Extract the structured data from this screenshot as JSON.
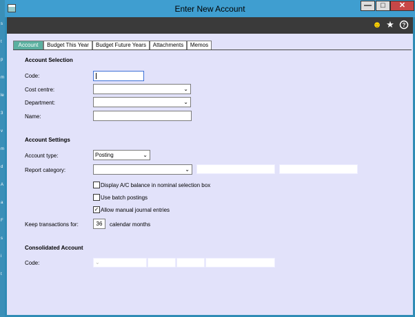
{
  "window": {
    "title": "Enter New Account",
    "controls": {
      "minimize": "—",
      "maximize": "□",
      "close": "✕"
    }
  },
  "edge_glyphs": [
    "s",
    "t",
    "p",
    "m",
    "le",
    "3",
    "v",
    "m",
    "d",
    "A",
    "a",
    "F",
    "s",
    "i",
    "t"
  ],
  "header_icons": {
    "smile": "☻",
    "star": "★",
    "help": "?"
  },
  "tabs": [
    {
      "label": "Account",
      "active": true
    },
    {
      "label": "Budget This Year",
      "active": false
    },
    {
      "label": "Budget Future Years",
      "active": false
    },
    {
      "label": "Attachments",
      "active": false
    },
    {
      "label": "Memos",
      "active": false
    }
  ],
  "account_selection": {
    "heading": "Account Selection",
    "code_label": "Code:",
    "code_value": "",
    "cost_centre_label": "Cost centre:",
    "cost_centre_value": "",
    "department_label": "Department:",
    "department_value": "",
    "name_label": "Name:",
    "name_value": ""
  },
  "account_settings": {
    "heading": "Account Settings",
    "account_type_label": "Account type:",
    "account_type_value": "Posting",
    "report_category_label": "Report category:",
    "report_category_value": "",
    "display_balance_label": "Display A/C balance in nominal selection box",
    "display_balance_checked": false,
    "batch_postings_label": "Use batch postings",
    "batch_postings_checked": false,
    "manual_journal_label": "Allow manual journal entries",
    "manual_journal_checked": true,
    "keep_transactions_label": "Keep transactions for:",
    "keep_transactions_value": "36",
    "keep_transactions_unit": "calendar  months"
  },
  "consolidated_account": {
    "heading": "Consolidated Account",
    "code_label": "Code:"
  },
  "icons": {
    "dropdown": "⌄",
    "checkmark": "✓"
  },
  "colors": {
    "title_bar": "#3f9ed0",
    "close_button": "#c74747",
    "active_tab": "#5bb0a0",
    "panel_background": "#e2e2fa"
  }
}
